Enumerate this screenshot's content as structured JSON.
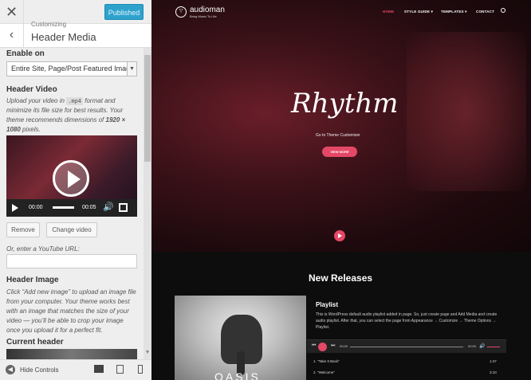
{
  "colors": {
    "accent": "#2ea2cc",
    "brand_pink": "#e54866",
    "panel_bg": "#eeeeee"
  },
  "topbar": {
    "close_icon": "close-icon",
    "publish_label": "Published"
  },
  "section": {
    "breadcrumb": "Customizing",
    "title": "Header Media"
  },
  "enable_on": {
    "label": "Enable on",
    "selected": "Entire Site, Page/Post Featured Image"
  },
  "header_video": {
    "label": "Header Video",
    "desc_1": "Upload your video in ",
    "format": ".mp4",
    "desc_2": " format and minimize its file size for best results. Your theme recommends dimensions of ",
    "dimensions": "1920 × 1080",
    "desc_3": " pixels.",
    "player": {
      "current_time": "00:00",
      "duration": "00:05",
      "progress": 0
    },
    "remove_label": "Remove",
    "change_label": "Change video",
    "youtube_label": "Or, enter a YouTube URL:",
    "youtube_value": ""
  },
  "header_image": {
    "label": "Header Image",
    "desc": "Click “Add new image” to upload an image file from your computer. Your theme works best with an image that matches the size of your video — you’ll be able to crop your image once you upload it for a perfect fit.",
    "current_label": "Current header"
  },
  "footer": {
    "hide_label": "Hide Controls"
  },
  "site": {
    "name": "audioman",
    "tagline": "Bring Music To Life",
    "nav": [
      "HOME",
      "STYLE GUIDE ▾",
      "TEMPLATES ▾",
      "CONTACT"
    ],
    "hero_title": "Rhythm",
    "hero_sub": "Go to Theme Customizer",
    "hero_button": "VIEW MORE",
    "releases_title": "New Releases",
    "album_text": "OASIS",
    "playlist_title": "Playlist",
    "playlist_desc": "This is WordPress default audio playlist added in page. So, just create page and Add Media and create audio playlist. After that, you can select the page from Appearance → Customize → Theme Options → Playlist.",
    "player": {
      "current_time": "00:00",
      "duration": "00:00"
    },
    "tracks": [
      {
        "title": "1. \"Take It Back\"",
        "duration": "1:47"
      },
      {
        "title": "2. \"Welcome\"",
        "duration": "3:10"
      }
    ]
  }
}
